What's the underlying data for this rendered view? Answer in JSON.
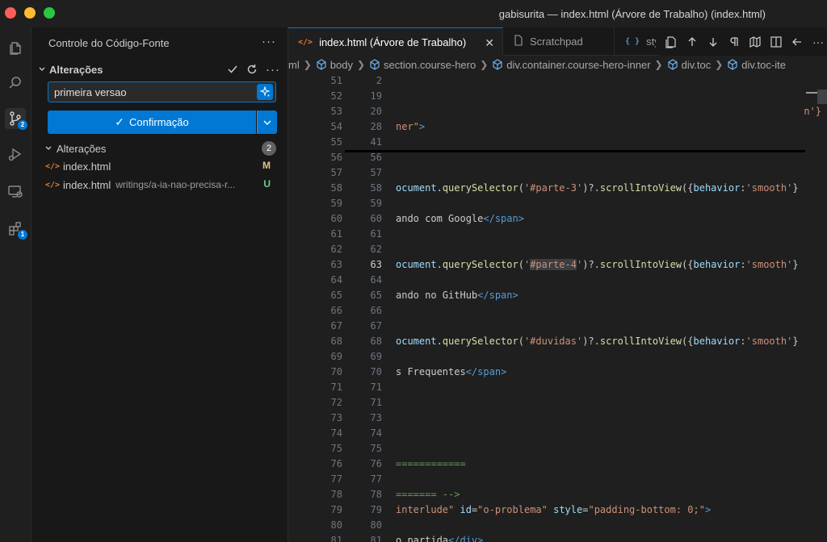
{
  "window": {
    "title": "gabisurita — index.html (Árvore de Trabalho) (index.html)"
  },
  "activity_bar": {
    "items": [
      {
        "name": "explorer",
        "icon": "files-icon"
      },
      {
        "name": "search",
        "icon": "search-icon"
      },
      {
        "name": "source-control",
        "icon": "source-control-icon",
        "badge": "2"
      },
      {
        "name": "run-debug",
        "icon": "run-debug-icon"
      },
      {
        "name": "remote-explorer",
        "icon": "remote-explorer-icon"
      },
      {
        "name": "extensions",
        "icon": "extensions-icon",
        "badge": "1"
      }
    ]
  },
  "sidebar": {
    "title": "Controle do Código-Fonte",
    "more_label": "···",
    "section": {
      "label": "Alterações",
      "actions": [
        "check-icon",
        "refresh-icon",
        "more-icon"
      ],
      "more_label": "···"
    },
    "commit": {
      "message": "primeira versao",
      "button_label": "Confirmação",
      "button_check": "✓"
    },
    "changes": {
      "label": "Alterações",
      "count": "2",
      "files": [
        {
          "name": "index.html",
          "path": "",
          "status": "M"
        },
        {
          "name": "index.html",
          "path": "writings/a-ia-nao-precisa-r...",
          "status": "U"
        }
      ]
    }
  },
  "editor": {
    "tabs": [
      {
        "label": "index.html (Árvore de Trabalho)",
        "icon": "</>",
        "active": true,
        "close": "✕"
      },
      {
        "label": "Scratchpad",
        "icon": "file-icon",
        "active": false
      },
      {
        "label": "sty",
        "icon": "{ }",
        "active": false
      }
    ],
    "breadcrumbs": [
      "ml",
      "body",
      "section.course-hero",
      "div.container.course-hero-inner",
      "div.toc",
      "div.toc-ite"
    ],
    "lines": [
      {
        "a": "51",
        "b": "2",
        "code": []
      },
      {
        "a": "52",
        "b": "19",
        "code": []
      },
      {
        "a": "53",
        "b": "20",
        "code": [
          {
            "t": "n'}",
            "c": "c-orange"
          }
        ],
        "right": true
      },
      {
        "a": "54",
        "b": "28",
        "code": [
          {
            "t": "ner\"",
            "c": "c-orange"
          },
          {
            "t": ">",
            "c": "c-blue"
          }
        ]
      },
      {
        "a": "55",
        "b": "41",
        "code": []
      },
      {
        "a": "56",
        "b": "56",
        "code": []
      },
      {
        "a": "57",
        "b": "57",
        "code": []
      },
      {
        "a": "58",
        "b": "58",
        "code": [
          {
            "t": "ocument.",
            "c": "c-cyan"
          },
          {
            "t": "querySelector",
            "c": "c-yellow"
          },
          {
            "t": "(",
            "c": ""
          },
          {
            "t": "'#parte-3'",
            "c": "c-orange"
          },
          {
            "t": ")?.",
            "c": ""
          },
          {
            "t": "scrollIntoView",
            "c": "c-yellow"
          },
          {
            "t": "({",
            "c": ""
          },
          {
            "t": "behavior",
            "c": "c-cyan"
          },
          {
            "t": ":",
            "c": ""
          },
          {
            "t": "'smooth'",
            "c": "c-orange"
          },
          {
            "t": "}",
            "c": ""
          }
        ]
      },
      {
        "a": "59",
        "b": "59",
        "code": []
      },
      {
        "a": "60",
        "b": "60",
        "code": [
          {
            "t": "ando com Google",
            "c": ""
          },
          {
            "t": "</",
            "c": "c-blue"
          },
          {
            "t": "span",
            "c": "c-blue"
          },
          {
            "t": ">",
            "c": "c-blue"
          }
        ]
      },
      {
        "a": "61",
        "b": "61",
        "code": []
      },
      {
        "a": "62",
        "b": "62",
        "code": []
      },
      {
        "a": "63",
        "b": "63",
        "cur": true,
        "code": [
          {
            "t": "ocument.",
            "c": "c-cyan"
          },
          {
            "t": "querySelector",
            "c": "c-yellow"
          },
          {
            "t": "(",
            "c": ""
          },
          {
            "t": "'",
            "c": "c-orange"
          },
          {
            "t": "#parte-4",
            "c": "c-orange hl"
          },
          {
            "t": "'",
            "c": "c-orange"
          },
          {
            "t": ")?.",
            "c": ""
          },
          {
            "t": "scrollIntoView",
            "c": "c-yellow"
          },
          {
            "t": "({",
            "c": ""
          },
          {
            "t": "behavior",
            "c": "c-cyan"
          },
          {
            "t": ":",
            "c": ""
          },
          {
            "t": "'smooth'",
            "c": "c-orange"
          },
          {
            "t": "}",
            "c": ""
          }
        ]
      },
      {
        "a": "64",
        "b": "64",
        "code": []
      },
      {
        "a": "65",
        "b": "65",
        "code": [
          {
            "t": "ando no GitHub",
            "c": ""
          },
          {
            "t": "</",
            "c": "c-blue"
          },
          {
            "t": "span",
            "c": "c-blue"
          },
          {
            "t": ">",
            "c": "c-blue"
          }
        ]
      },
      {
        "a": "66",
        "b": "66",
        "code": []
      },
      {
        "a": "67",
        "b": "67",
        "code": []
      },
      {
        "a": "68",
        "b": "68",
        "code": [
          {
            "t": "ocument.",
            "c": "c-cyan"
          },
          {
            "t": "querySelector",
            "c": "c-yellow"
          },
          {
            "t": "(",
            "c": ""
          },
          {
            "t": "'#duvidas'",
            "c": "c-orange"
          },
          {
            "t": ")?.",
            "c": ""
          },
          {
            "t": "scrollIntoView",
            "c": "c-yellow"
          },
          {
            "t": "({",
            "c": ""
          },
          {
            "t": "behavior",
            "c": "c-cyan"
          },
          {
            "t": ":",
            "c": ""
          },
          {
            "t": "'smooth'",
            "c": "c-orange"
          },
          {
            "t": "}",
            "c": ""
          }
        ]
      },
      {
        "a": "69",
        "b": "69",
        "code": []
      },
      {
        "a": "70",
        "b": "70",
        "code": [
          {
            "t": "s Frequentes",
            "c": ""
          },
          {
            "t": "</",
            "c": "c-blue"
          },
          {
            "t": "span",
            "c": "c-blue"
          },
          {
            "t": ">",
            "c": "c-blue"
          }
        ]
      },
      {
        "a": "71",
        "b": "71",
        "code": []
      },
      {
        "a": "72",
        "b": "71",
        "code": []
      },
      {
        "a": "73",
        "b": "73",
        "code": []
      },
      {
        "a": "74",
        "b": "74",
        "code": []
      },
      {
        "a": "75",
        "b": "75",
        "code": []
      },
      {
        "a": "76",
        "b": "76",
        "code": [
          {
            "t": "============",
            "c": "c-green"
          }
        ]
      },
      {
        "a": "77",
        "b": "77",
        "code": []
      },
      {
        "a": "78",
        "b": "78",
        "code": [
          {
            "t": "======= -->",
            "c": "c-green"
          }
        ]
      },
      {
        "a": "79",
        "b": "79",
        "code": [
          {
            "t": "interlude\"",
            "c": "c-orange"
          },
          {
            "t": " ",
            "c": ""
          },
          {
            "t": "id",
            "c": "c-cyan"
          },
          {
            "t": "=",
            "c": ""
          },
          {
            "t": "\"o-problema\"",
            "c": "c-orange"
          },
          {
            "t": " ",
            "c": ""
          },
          {
            "t": "style",
            "c": "c-cyan"
          },
          {
            "t": "=",
            "c": ""
          },
          {
            "t": "\"padding-bottom: 0;\"",
            "c": "c-orange"
          },
          {
            "t": ">",
            "c": "c-blue"
          }
        ]
      },
      {
        "a": "80",
        "b": "80",
        "code": []
      },
      {
        "a": "81",
        "b": "81",
        "code": [
          {
            "t": "o partida",
            "c": ""
          },
          {
            "t": "</",
            "c": "c-blue"
          },
          {
            "t": "div",
            "c": "c-blue"
          },
          {
            "t": ">",
            "c": "c-blue"
          }
        ]
      }
    ]
  }
}
